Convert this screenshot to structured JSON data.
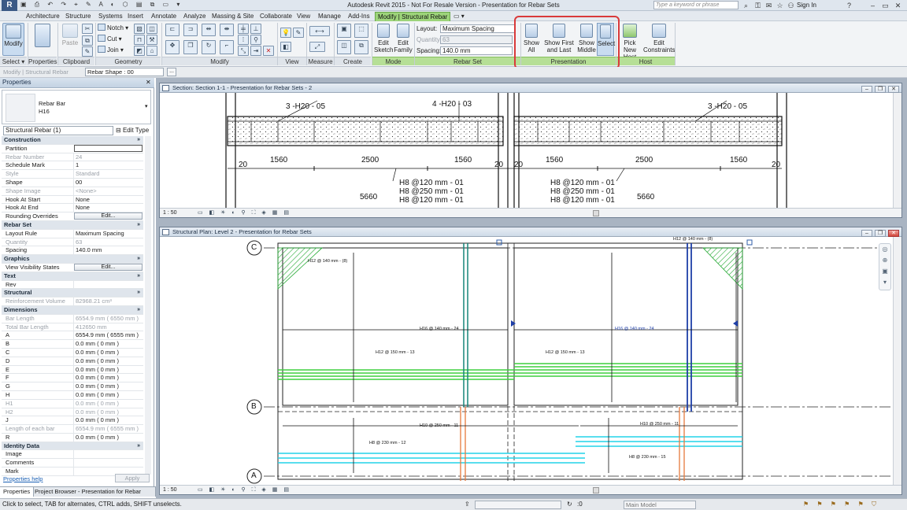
{
  "window": {
    "title": "Autodesk Revit 2015 - Not For Resale Version -    Presentation for Rebar Sets",
    "search_placeholder": "Type a keyword or phrase",
    "sign_in": "Sign In"
  },
  "tabs": [
    "Architecture",
    "Structure",
    "Systems",
    "Insert",
    "Annotate",
    "Analyze",
    "Massing & Site",
    "Collaborate",
    "View",
    "Manage",
    "Add-Ins",
    "Modify | Structural Rebar"
  ],
  "ribbon": {
    "select": {
      "modify": "Modify",
      "select_menu": "Select ▾"
    },
    "properties": {
      "label": "Properties"
    },
    "clipboard": {
      "paste": "Paste",
      "label": "Clipboard"
    },
    "geometry": {
      "notch": "Notch ▾",
      "cut": "Cut ▾",
      "join": "Join ▾",
      "label": "Geometry"
    },
    "modify": {
      "label": "Modify"
    },
    "view": {
      "label": "View"
    },
    "measure": {
      "label": "Measure"
    },
    "create": {
      "label": "Create"
    },
    "mode": {
      "edit_sketch": "Edit Sketch",
      "edit_family": "Edit Family",
      "label": "Mode"
    },
    "rebar_set": {
      "layout_label": "Layout:",
      "layout_value": "Maximum Spacing",
      "quantity_label": "Quantity:",
      "quantity_value": "63",
      "spacing_label": "Spacing:",
      "spacing_value": "140.0 mm",
      "label": "Rebar Set"
    },
    "presentation": {
      "show_all": "Show All",
      "show_first_last": "Show First and Last",
      "show_middle": "Show Middle",
      "select": "Select",
      "label": "Presentation"
    },
    "host": {
      "pick_new_host": "Pick New Host",
      "edit_constraints": "Edit Constraints",
      "label": "Host"
    }
  },
  "options_bar": {
    "context": "Modify | Structural Rebar",
    "rebar_shape_label": "Rebar Shape : 00",
    "more": "..."
  },
  "properties": {
    "title": "Properties",
    "type_name": "Rebar Bar",
    "type_sub": "H16",
    "instance_selector": "Structural Rebar (1)",
    "edit_type": "Edit Type",
    "rows": [
      {
        "k": "Construction",
        "grp": true
      },
      {
        "k": "Partition",
        "v": "",
        "input": true
      },
      {
        "k": "Rebar Number",
        "v": "24",
        "dis": true
      },
      {
        "k": "Schedule Mark",
        "v": "1"
      },
      {
        "k": "Style",
        "v": "Standard",
        "dis": true
      },
      {
        "k": "Shape",
        "v": "00"
      },
      {
        "k": "Shape Image",
        "v": "<None>",
        "dis": true
      },
      {
        "k": "Hook At Start",
        "v": "None"
      },
      {
        "k": "Hook At End",
        "v": "None"
      },
      {
        "k": "Rounding Overrides",
        "v": "Edit...",
        "btn": true
      },
      {
        "k": "Rebar Set",
        "grp": true
      },
      {
        "k": "Layout Rule",
        "v": "Maximum Spacing"
      },
      {
        "k": "Quantity",
        "v": "63",
        "dis": true
      },
      {
        "k": "Spacing",
        "v": "140.0 mm"
      },
      {
        "k": "Graphics",
        "grp": true
      },
      {
        "k": "View Visibility States",
        "v": "Edit...",
        "btn": true
      },
      {
        "k": "Text",
        "grp": true
      },
      {
        "k": "Rev",
        "v": ""
      },
      {
        "k": "Structural",
        "grp": true
      },
      {
        "k": "Reinforcement Volume",
        "v": "82968.21 cm³",
        "dis": true
      },
      {
        "k": "Dimensions",
        "grp": true
      },
      {
        "k": "Bar Length",
        "v": "6554.9 mm ( 6550 mm )",
        "dis": true
      },
      {
        "k": "Total Bar Length",
        "v": "412650 mm",
        "dis": true
      },
      {
        "k": "A",
        "v": "6554.9 mm ( 6555 mm )"
      },
      {
        "k": "B",
        "v": "0.0 mm ( 0 mm )"
      },
      {
        "k": "C",
        "v": "0.0 mm ( 0 mm )"
      },
      {
        "k": "D",
        "v": "0.0 mm ( 0 mm )"
      },
      {
        "k": "E",
        "v": "0.0 mm ( 0 mm )"
      },
      {
        "k": "F",
        "v": "0.0 mm ( 0 mm )"
      },
      {
        "k": "G",
        "v": "0.0 mm ( 0 mm )"
      },
      {
        "k": "H",
        "v": "0.0 mm ( 0 mm )"
      },
      {
        "k": "H1",
        "v": "0.0 mm ( 0 mm )",
        "dis": true
      },
      {
        "k": "H2",
        "v": "0.0 mm ( 0 mm )",
        "dis": true
      },
      {
        "k": "J",
        "v": "0.0 mm ( 0 mm )"
      },
      {
        "k": "Length of each bar",
        "v": "6554.9 mm ( 6555 mm )",
        "dis": true
      },
      {
        "k": "R",
        "v": "0.0 mm ( 0 mm )"
      },
      {
        "k": "Identity Data",
        "grp": true
      },
      {
        "k": "Image",
        "v": ""
      },
      {
        "k": "Comments",
        "v": ""
      },
      {
        "k": "Mark",
        "v": ""
      }
    ],
    "help": "Properties help",
    "apply": "Apply"
  },
  "bottom_tabs": [
    "Properties",
    "Project Browser - Presentation for Rebar Sets"
  ],
  "section_view": {
    "title": "Section: Section 1-1 - Presentation for Rebar Sets - 2",
    "scale": "1 : 50",
    "labels": {
      "top_left": "3 -H20 - 05",
      "top_mid": "4 -H20 - 03",
      "top_right": "3 -H20 - 05",
      "d1": "1560",
      "d2": "2500",
      "d3": "1560",
      "d4": "1560",
      "d5": "2500",
      "d6": "1560",
      "e1": "20",
      "e2": "20",
      "e3": "20",
      "e4": "20",
      "s1a": "H8 @120 mm - 01",
      "s1b": "H8 @250 mm - 01",
      "s1c": "H8 @120 mm - 01",
      "s2a": "H8 @120 mm - 01",
      "s2b": "H8 @250 mm - 01",
      "s2c": "H8 @120 mm - 01",
      "w1": "5660",
      "w2": "5660"
    }
  },
  "plan_view": {
    "title": "Structural Plan: Level 2 - Presentation for Rebar Sets",
    "scale": "1 : 50",
    "grids": [
      "C",
      "B",
      "A"
    ],
    "labels": {
      "l1": "H12 @ 140 mm - (8)",
      "l2": "H12 @ 140 mm - (8)",
      "l3": "H16 @ 140 mm - 24",
      "l4": "H16 @ 140 mm - 24",
      "l5": "H12 @ 150 mm - 13",
      "l6": "H12 @ 150 mm - 13",
      "l7": "H10 @ 250 mm - 11",
      "l8": "H10 @ 250 mm - 11",
      "l9": "H8 @ 230 mm - 12",
      "l10": "H8 @ 230 mm - 15"
    }
  },
  "status": {
    "text": "Click to select, TAB for alternates, CTRL adds, SHIFT unselects.",
    "zero": ":0",
    "main_model": "Main Model"
  },
  "colors": {
    "context_tab": "#9dd47a",
    "highlight": "#d93a3a",
    "selected_bar": "#1f3fa8",
    "green_bar": "#3fcf3f",
    "teal_bar": "#17867a",
    "cyan_bar": "#22d3e8",
    "orange_bar": "#e67a3c"
  }
}
